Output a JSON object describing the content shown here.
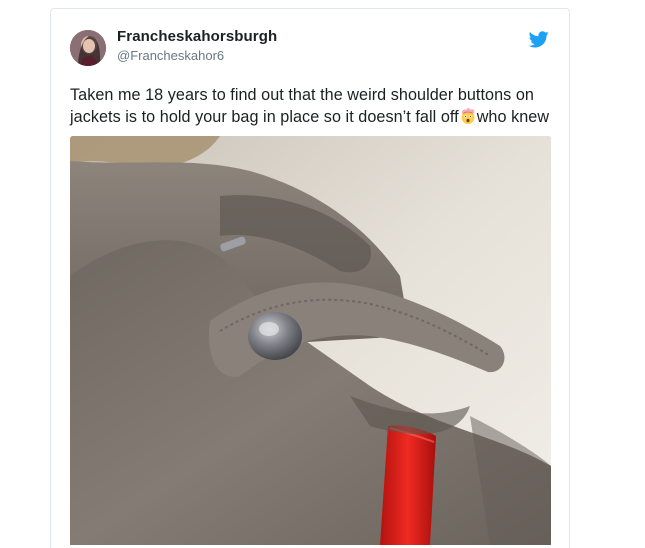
{
  "tweet": {
    "display_name": "Francheskahorsburgh",
    "handle": "@Francheskahor6",
    "text_before_emoji": "Taken me 18 years to find out that the weird shoulder buttons on jackets is to hold your bag in place so it doesn’t fall off",
    "text_after_emoji": "who knew",
    "emoji": "exploding-head-emoji",
    "brand_icon": "twitter-bird-icon",
    "accent_color": "#1da1f2"
  },
  "media": {
    "type": "photo",
    "subject": "suede jacket shoulder strap with snap button holding a red bag strap"
  }
}
